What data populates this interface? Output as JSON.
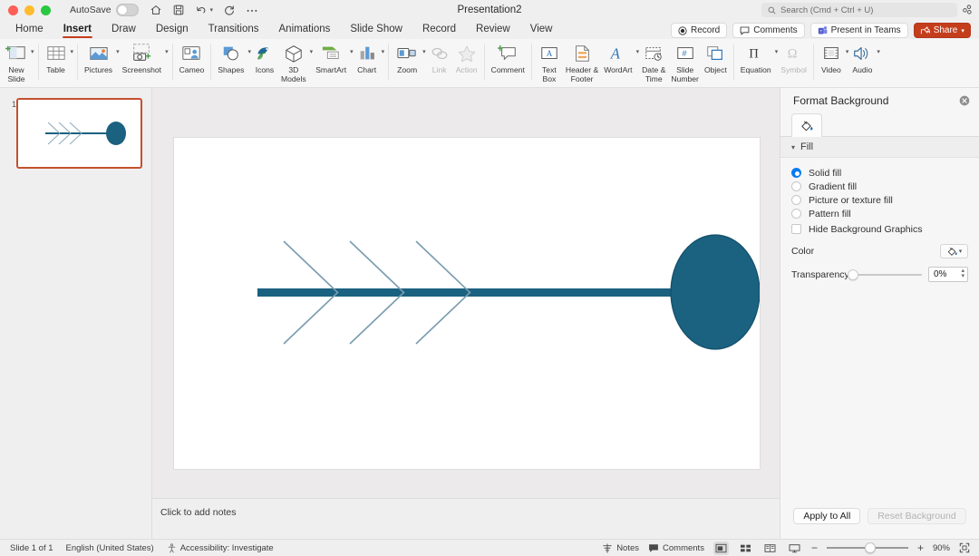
{
  "window": {
    "autosave_label": "AutoSave",
    "autosave_state": "off",
    "document_title": "Presentation2",
    "search_placeholder": "Search (Cmd + Ctrl + U)"
  },
  "tabs": [
    {
      "label": "Home",
      "active": false
    },
    {
      "label": "Insert",
      "active": true
    },
    {
      "label": "Draw",
      "active": false
    },
    {
      "label": "Design",
      "active": false
    },
    {
      "label": "Transitions",
      "active": false
    },
    {
      "label": "Animations",
      "active": false
    },
    {
      "label": "Slide Show",
      "active": false
    },
    {
      "label": "Record",
      "active": false
    },
    {
      "label": "Review",
      "active": false
    },
    {
      "label": "View",
      "active": false
    }
  ],
  "top_buttons": [
    {
      "label": "Record",
      "icon": "record-icon"
    },
    {
      "label": "Comments",
      "icon": "comment-bubble-icon"
    },
    {
      "label": "Present in Teams",
      "icon": "teams-icon"
    },
    {
      "label": "Share",
      "icon": "share-icon",
      "accent": "#c43e1c"
    }
  ],
  "ribbon": {
    "groups": [
      {
        "items": [
          {
            "label": "New\nSlide",
            "icon": "new-slide-icon",
            "caret": true,
            "dim": false
          }
        ]
      },
      {
        "items": [
          {
            "label": "Table",
            "icon": "table-icon",
            "caret": true,
            "dim": false
          }
        ]
      },
      {
        "items": [
          {
            "label": "Pictures",
            "icon": "pictures-icon",
            "caret": true,
            "dim": false
          },
          {
            "label": "Screenshot",
            "icon": "screenshot-icon",
            "caret": true,
            "dim": false
          }
        ]
      },
      {
        "items": [
          {
            "label": "Cameo",
            "icon": "cameo-icon",
            "caret": false,
            "dim": false
          }
        ]
      },
      {
        "items": [
          {
            "label": "Shapes",
            "icon": "shapes-icon",
            "caret": true,
            "dim": false
          },
          {
            "label": "Icons",
            "icon": "icons-icon",
            "caret": false,
            "dim": false
          },
          {
            "label": "3D\nModels",
            "icon": "3d-models-icon",
            "caret": true,
            "dim": false
          },
          {
            "label": "SmartArt",
            "icon": "smartart-icon",
            "caret": true,
            "dim": false
          },
          {
            "label": "Chart",
            "icon": "chart-icon",
            "caret": true,
            "dim": false
          }
        ]
      },
      {
        "items": [
          {
            "label": "Zoom",
            "icon": "zoom-icon",
            "caret": true,
            "dim": false
          },
          {
            "label": "Link",
            "icon": "link-icon",
            "caret": false,
            "dim": true
          },
          {
            "label": "Action",
            "icon": "action-star-icon",
            "caret": false,
            "dim": true
          }
        ]
      },
      {
        "items": [
          {
            "label": "Comment",
            "icon": "comment-icon",
            "caret": false,
            "dim": false
          }
        ]
      },
      {
        "items": [
          {
            "label": "Text\nBox",
            "icon": "text-box-icon",
            "caret": false,
            "dim": false
          },
          {
            "label": "Header &\nFooter",
            "icon": "header-footer-icon",
            "caret": false,
            "dim": false
          },
          {
            "label": "WordArt",
            "icon": "wordart-icon",
            "caret": true,
            "dim": false
          },
          {
            "label": "Date &\nTime",
            "icon": "date-time-icon",
            "caret": false,
            "dim": false
          },
          {
            "label": "Slide\nNumber",
            "icon": "slide-number-icon",
            "caret": false,
            "dim": false
          },
          {
            "label": "Object",
            "icon": "object-icon",
            "caret": false,
            "dim": false
          }
        ]
      },
      {
        "items": [
          {
            "label": "Equation",
            "icon": "equation-icon",
            "caret": true,
            "dim": false
          },
          {
            "label": "Symbol",
            "icon": "symbol-icon",
            "caret": false,
            "dim": true
          }
        ]
      },
      {
        "items": [
          {
            "label": "Video",
            "icon": "video-icon",
            "caret": true,
            "dim": false
          },
          {
            "label": "Audio",
            "icon": "audio-icon",
            "caret": true,
            "dim": false
          }
        ]
      }
    ]
  },
  "thumbnails": [
    {
      "number": "1",
      "selected": true
    }
  ],
  "slide": {
    "diagram": {
      "type": "fishbone",
      "spine_color": "#1b6180",
      "head_color": "#1b6180",
      "bone_color": "#7a9cb0"
    }
  },
  "notes": {
    "placeholder": "Click to add notes"
  },
  "format_pane": {
    "title": "Format Background",
    "close_icon": "close-icon",
    "tab_icon": "fill-bucket-icon",
    "section_title": "Fill",
    "fill_options": [
      {
        "label": "Solid fill",
        "selected": true
      },
      {
        "label": "Gradient fill",
        "selected": false
      },
      {
        "label": "Picture or texture fill",
        "selected": false
      },
      {
        "label": "Pattern fill",
        "selected": false
      }
    ],
    "hide_background_label": "Hide Background Graphics",
    "hide_background_checked": false,
    "color_label": "Color",
    "color_icon": "fill-bucket-icon",
    "transparency_label": "Transparency",
    "transparency_value": "0%",
    "apply_to_all_label": "Apply to All",
    "reset_background_label": "Reset Background"
  },
  "status_bar": {
    "slide_count": "Slide 1 of 1",
    "language": "English (United States)",
    "accessibility": "Accessibility: Investigate",
    "notes_label": "Notes",
    "comments_label": "Comments",
    "zoom_level": "90%",
    "view_buttons": [
      {
        "name": "normal-view",
        "selected": true
      },
      {
        "name": "slide-sorter-view",
        "selected": false
      },
      {
        "name": "reading-view",
        "selected": false
      },
      {
        "name": "presenter-view",
        "selected": false
      }
    ]
  }
}
